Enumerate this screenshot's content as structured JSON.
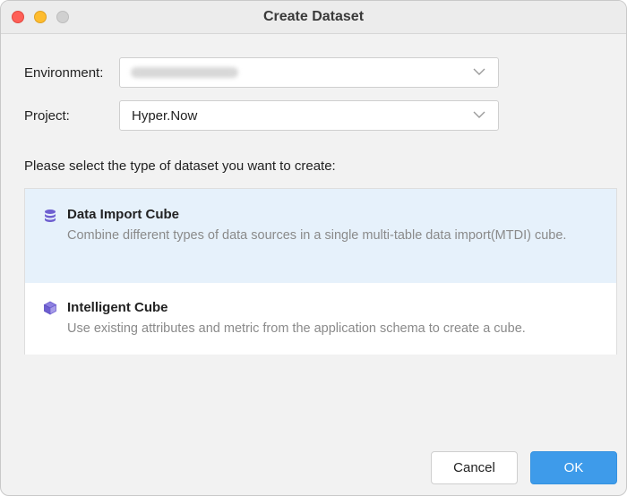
{
  "window": {
    "title": "Create Dataset"
  },
  "form": {
    "environment_label": "Environment:",
    "environment_value": "",
    "project_label": "Project:",
    "project_value": "Hyper.Now"
  },
  "prompt": "Please select the type of dataset you want to create:",
  "options": [
    {
      "title": "Data Import Cube",
      "description": "Combine different types of data sources in a single multi-table data import(MTDI) cube.",
      "icon": "database-icon",
      "selected": true
    },
    {
      "title": "Intelligent Cube",
      "description": "Use existing attributes and metric from the application schema to create a cube.",
      "icon": "cube-icon",
      "selected": false
    }
  ],
  "buttons": {
    "cancel": "Cancel",
    "ok": "OK"
  },
  "colors": {
    "accent": "#3e9bea",
    "selected_bg": "#e6f1fb",
    "icon_purple": "#6e5fd0"
  }
}
